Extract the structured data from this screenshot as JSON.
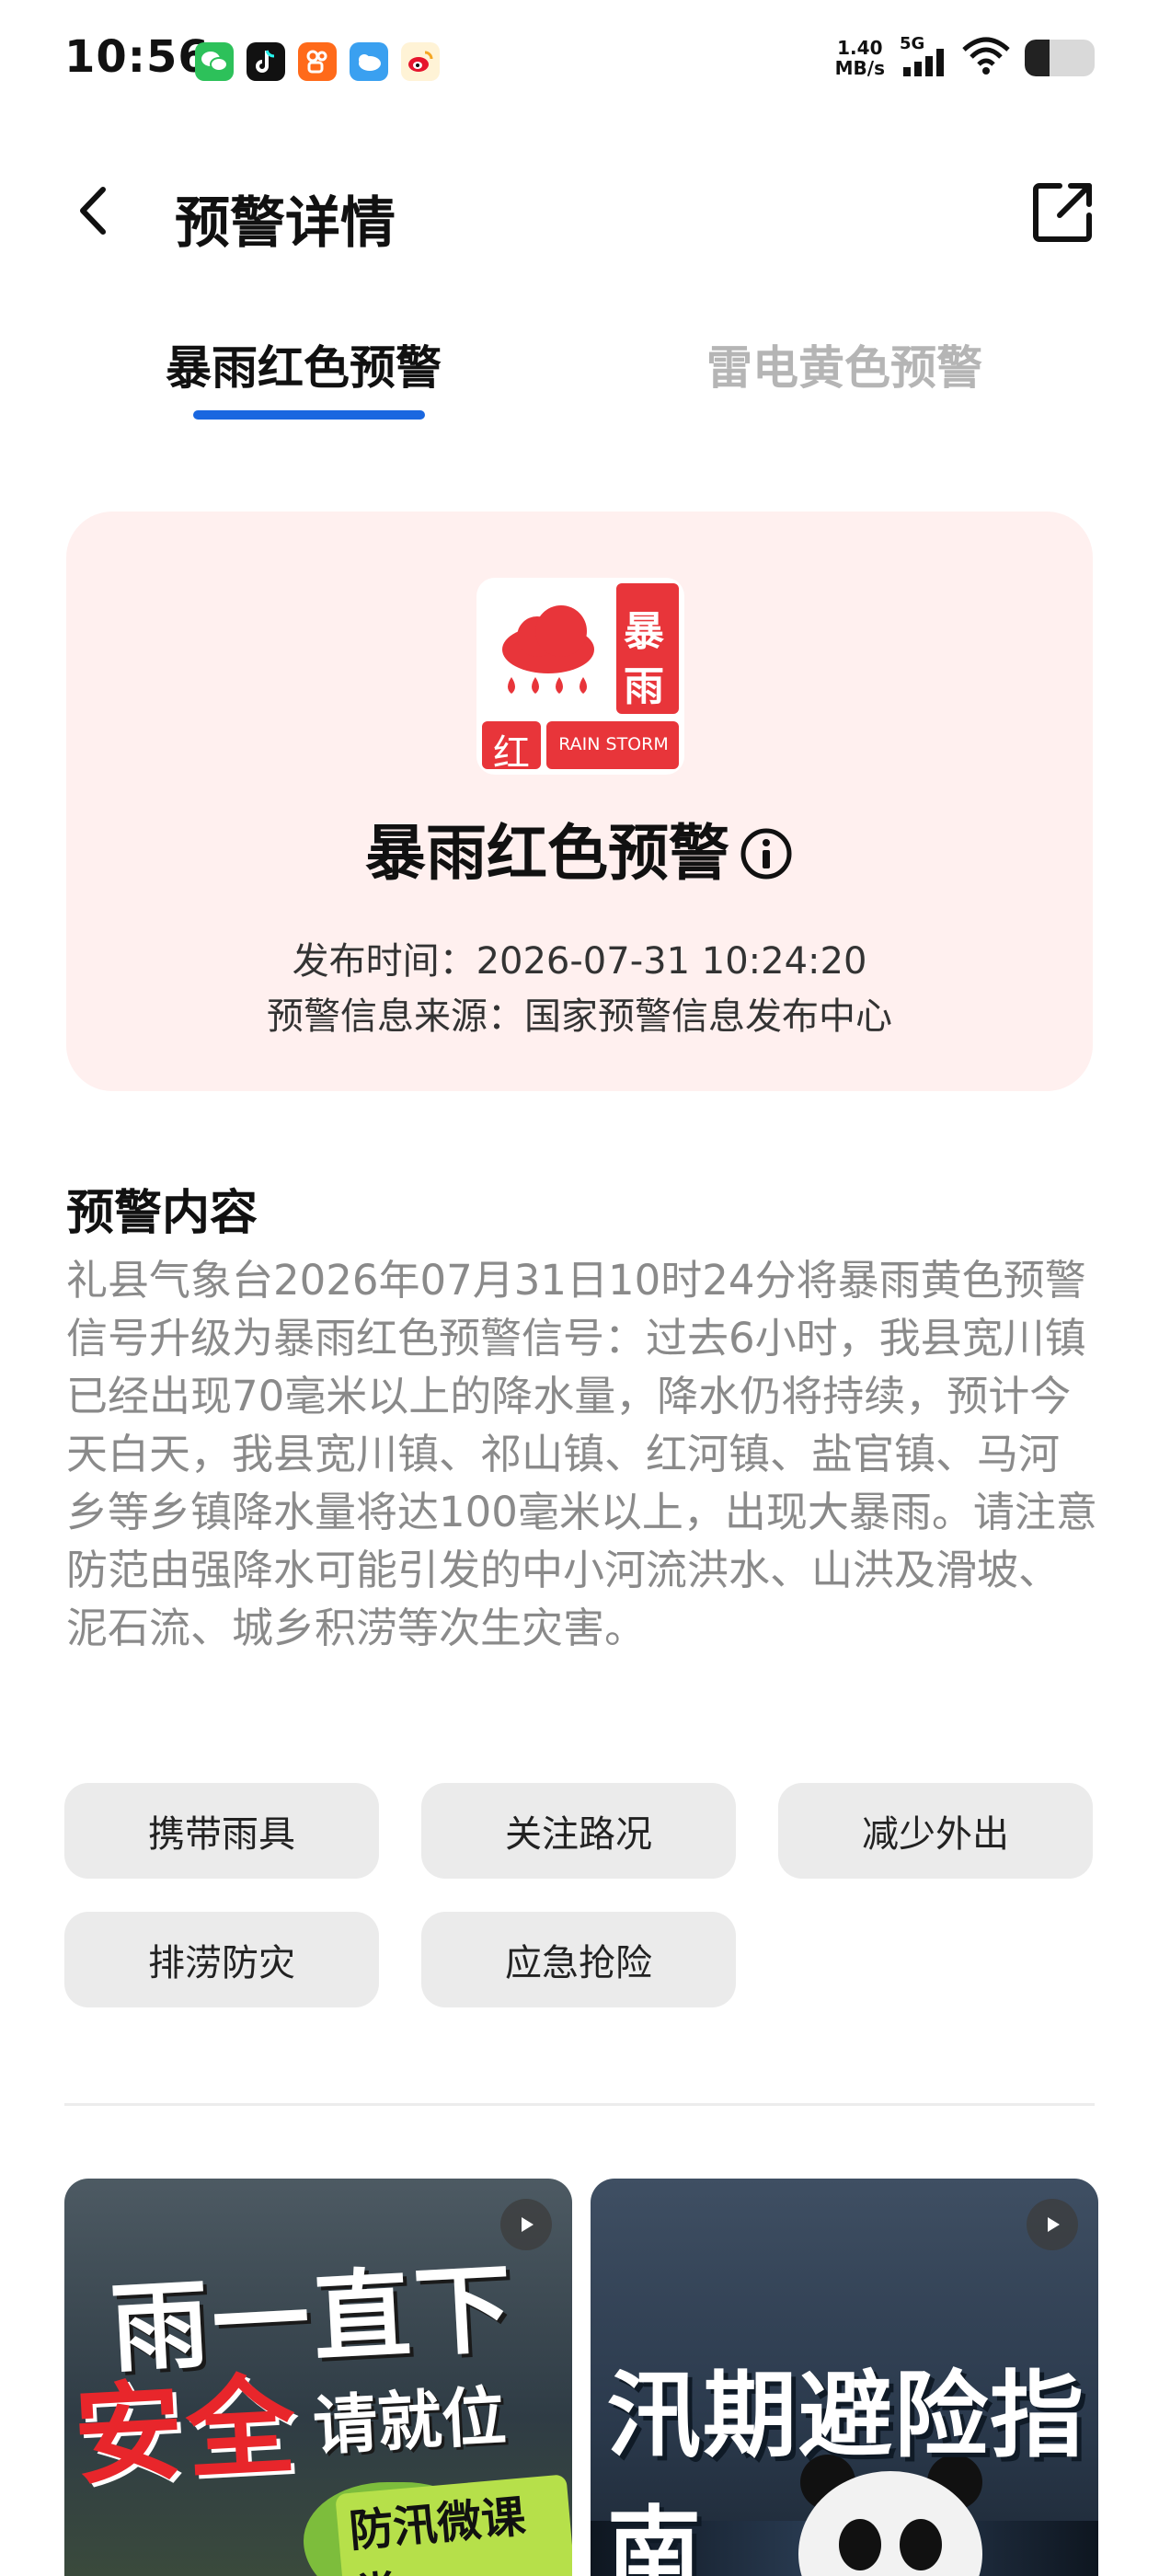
{
  "status_bar": {
    "time": "10:56",
    "net_speed_value": "1.40",
    "net_speed_unit": "MB/s",
    "network": "5G",
    "battery_level": 0.35,
    "apps": [
      "wechat-icon",
      "tiktok-icon",
      "kuaishou-icon",
      "weather-app-icon",
      "weibo-icon"
    ]
  },
  "header": {
    "title": "预警详情"
  },
  "tabs": [
    {
      "label": "暴雨红色预警",
      "active": true
    },
    {
      "label": "雷电黄色预警",
      "active": false
    }
  ],
  "warning": {
    "icon_side_text_1": "暴",
    "icon_side_text_2": "雨",
    "icon_level_text": "红",
    "icon_caption": "RAIN STORM",
    "title": "暴雨红色预警",
    "publish_time": "发布时间：2026-07-31 10:24:20",
    "source": "预警信息来源：国家预警信息发布中心",
    "colors": {
      "red": "#e8353a",
      "card_bg": "#fff0ef"
    }
  },
  "content": {
    "section_title": "预警内容",
    "body": "礼县气象台2026年07月31日10时24分将暴雨黄色预警信号升级为暴雨红色预警信号：过去6小时，我县宽川镇已经出现70毫米以上的降水量，降水仍将持续，预计今天白天，我县宽川镇、祁山镇、红河镇、盐官镇、马河乡等乡镇降水量将达100毫米以上，出现大暴雨。请注意防范由强降水可能引发的中小河流洪水、山洪及滑坡、泥石流、城乡积涝等次生灾害。"
  },
  "actions": [
    "携带雨具",
    "关注路况",
    "减少外出",
    "排涝防灾",
    "应急抢险"
  ],
  "videos": [
    {
      "line1": "雨一直下",
      "line2": "安全",
      "line3": "请就位",
      "line4": "防汛微课堂"
    },
    {
      "line1": "汛期避险指南"
    }
  ]
}
